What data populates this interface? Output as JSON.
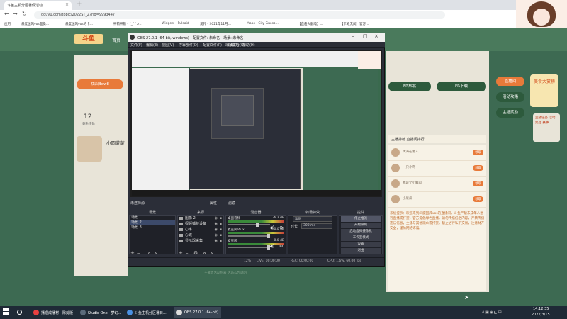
{
  "browser": {
    "tab_title": "斗鱼主机分区暑假活动",
    "tab_close": "×",
    "new_tab": "+",
    "back": "←",
    "forward": "→",
    "reload": "↻",
    "url": "douyu.com/topic/2022ST_Z?rid=9993447",
    "bookmarks": [
      "应用",
      "斜度国风vos面操…",
      "斜度国风vos的卡…",
      "神箭神箭 - ˇ_ˇ 'つ…",
      "Widgets - Pulsoid",
      "爱邦 - 2021年11月…",
      "Maps - City Guess…",
      "【直击大翻墙】…",
      "【卡殿无闻】官方…"
    ]
  },
  "site": {
    "logo": "斗鱼",
    "nav_first": "首页",
    "left_pill": "找回Bow8",
    "count_num": "12",
    "count_label": "剩余次数",
    "streamer_name": "小圆蒙蒙",
    "right_btn_1": "FR东北",
    "right_btn_2": "FR下载",
    "side_btn_1": "直播间",
    "side_btn_2": "活动攻略",
    "side_btn_3": "主播奖励",
    "promo_badge": "美食大赏榜",
    "promo_list": "主播任务 活动奖品 赛事",
    "chat_header": "主播排榜    直播间排行",
    "chat_rows": [
      {
        "name": "大海在港人",
        "tag": "领取"
      },
      {
        "name": "一只小鸟",
        "tag": "领取"
      },
      {
        "name": "我是个小鲜肉",
        "tag": "领取"
      },
      {
        "name": "小呆瓜",
        "tag": "领取"
      }
    ],
    "chat_notice": "系统提示：欢迎来到斜度国风vos的直播间，斗鱼严禁未成年人进行直播或打赏，官方提倡绿色直播，请勿传播低俗内容，严禁传播违法信息，主播与其他观众或打赏，禁止进行私下交易，注意财产安全，谨防网络诈骗。"
  },
  "obs": {
    "title": "OBS 27.0.1 (64-bit, windows) - 配置文件: 未命名 - 场景: 未命名",
    "min": "–",
    "max": "□",
    "close": "×",
    "menu": [
      "文件(F)",
      "编辑(E)",
      "视图(V)",
      "停靠部件(D)",
      "配置文件(P)",
      "场景集合(S)",
      "工具(T)",
      "帮助(H)"
    ],
    "scene_name": "未选择源",
    "props_btn": "属性",
    "filters_btn": "滤镜",
    "docks": {
      "scenes": "场景",
      "sources": "来源",
      "mixer": "混音器",
      "transitions": "转场特效",
      "controls": "控件"
    },
    "scenes": [
      "场景",
      "场景 2",
      "场景 3"
    ],
    "sources": [
      "图像 2",
      "视频捕获设备",
      "心率",
      "心跳",
      "显示器采集"
    ],
    "mixer": [
      {
        "name": "桌面音频",
        "db": "-6.2 dB"
      },
      {
        "name": "麦克风/Aux",
        "db": "0.0 dB"
      },
      {
        "name": "麦克风",
        "db": "0.0 dB"
      }
    ],
    "transition": {
      "type": "淡化",
      "duration_label": "时长",
      "duration": "300 ms"
    },
    "controls": [
      "停止推流",
      "开始录制",
      "启动虚拟摄像机",
      "工作室模式",
      "设置",
      "退出"
    ],
    "footer_plus": "+",
    "footer_minus": "–",
    "footer_gear": "⚙",
    "footer_up": "∧",
    "footer_down": "∨",
    "status": {
      "live": "LIVE: 00:00:00",
      "rec": "REC: 00:00:00",
      "cpu": "CPU: 1.6%, 60.00 fps",
      "dropped": "12%"
    }
  },
  "below_text": "主播音活动列表    活动公告说明",
  "taskbar": {
    "items": [
      "播理成播材 - 除剪版",
      "Studio One - 梦幻...",
      "斗鱼主机分区暑日...",
      "OBS 27.0.1 (64-bit)..."
    ],
    "tray": "ᐱ  ▣  ◉  ◣  中",
    "time": "14:12:35",
    "date": "2022/3/15"
  },
  "colors": {
    "accent": "#e87a3a",
    "site_green": "#3d6a52",
    "obs_bg": "#2b2e38"
  }
}
